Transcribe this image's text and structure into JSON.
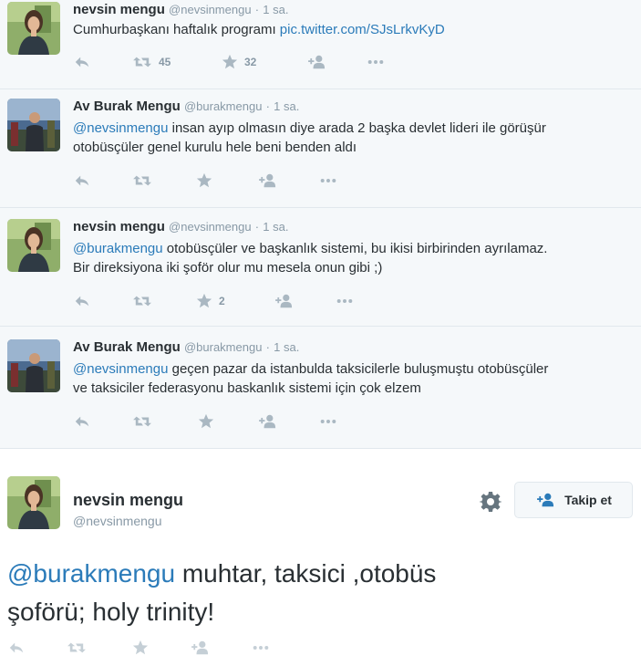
{
  "timeline": [
    {
      "fullname": "nevsin mengu",
      "username": "@nevsinmengu",
      "dot": "·",
      "time": "1 sa.",
      "avatar": "woman-portrait-avatar",
      "text_plain": "Cumhurbaşkanı haftalık programı ",
      "text_link": "pic.twitter.com/SJsLrkvKyD",
      "retweets": "45",
      "favorites": "32"
    },
    {
      "fullname": "Av Burak Mengu",
      "username": "@burakmengu",
      "dot": "·",
      "time": "1 sa.",
      "avatar": "man-outdoor-avatar",
      "mention": "@nevsinmengu",
      "line1_rest": " insan ayıp olmasın diye arada 2 başka devlet lideri ile görüşür",
      "line2": "otobüsçüler genel kurulu hele beni benden aldı"
    },
    {
      "fullname": "nevsin mengu",
      "username": "@nevsinmengu",
      "dot": "·",
      "time": "1 sa.",
      "avatar": "woman-portrait-avatar",
      "mention": "@burakmengu",
      "line1_rest": " otobüsçüler ve başkanlık sistemi, bu ikisi birbirinden ayrılamaz.",
      "line2": "Bir direksiyona iki şoför olur mu mesela onun gibi ;)",
      "favorites": "2"
    },
    {
      "fullname": "Av Burak Mengu",
      "username": "@burakmengu",
      "dot": "·",
      "time": "1 sa.",
      "avatar": "man-outdoor-avatar",
      "mention": "@nevsinmengu",
      "line1_rest": " geçen pazar da istanbulda taksicilerle buluşmuştu otobüsçüler",
      "line2": "ve taksiciler federasyonu baskanlık sistemi için çok elzem"
    }
  ],
  "permalink": {
    "fullname": "nevsin mengu",
    "username": "@nevsinmengu",
    "follow_label": "Takip et",
    "mention": "@burakmengu",
    "line1_rest": " muhtar, taksici ,otobüs",
    "line2": "şoförü; holy trinity!"
  },
  "colors": {
    "link": "#2b7bb9",
    "action_icon": "#aab8c2",
    "background": "#f5f8fa"
  },
  "icons": [
    "reply-icon",
    "retweet-icon",
    "favorite-star-icon",
    "follow-icon",
    "more-dots-icon",
    "gear-icon"
  ]
}
